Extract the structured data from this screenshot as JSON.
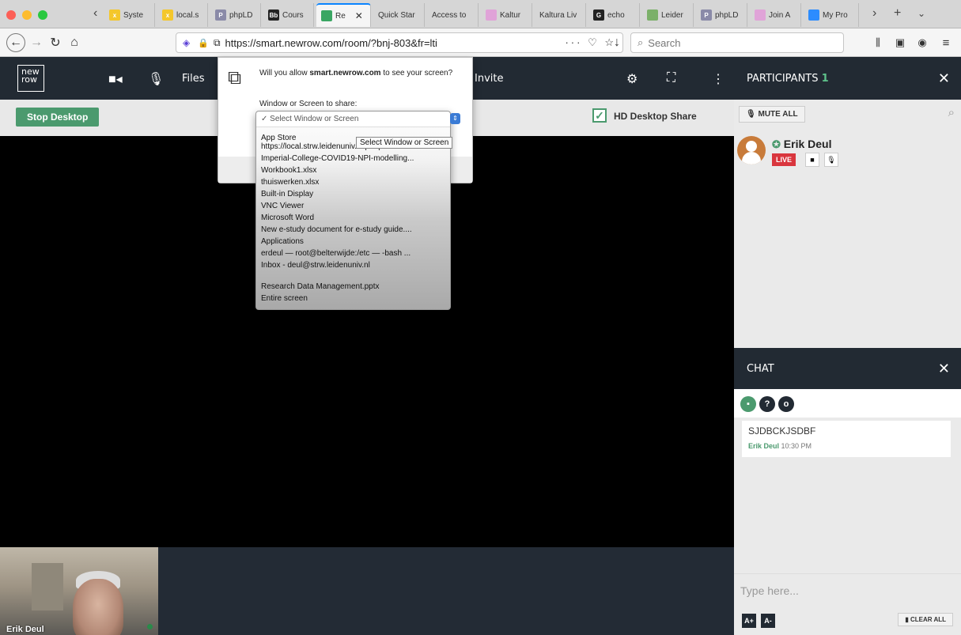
{
  "browser": {
    "tabs": [
      {
        "label": "Syste",
        "fav_color": "#f4c72b",
        "fav_text": "x"
      },
      {
        "label": "local.s",
        "fav_color": "#f4c72b",
        "fav_text": "x"
      },
      {
        "label": "phpLD",
        "fav_color": "#8a8aa8",
        "fav_text": "P"
      },
      {
        "label": "Cours",
        "fav_color": "#222222",
        "fav_text": "Bb"
      },
      {
        "label": "Re",
        "fav_color": "#3aa663",
        "fav_text": ""
      },
      {
        "label": "Quick Star",
        "fav_color": "",
        "fav_text": ""
      },
      {
        "label": "Access to",
        "fav_color": "",
        "fav_text": ""
      },
      {
        "label": "Kaltur",
        "fav_color": "#e0a3d8",
        "fav_text": ""
      },
      {
        "label": "Kaltura Liv",
        "fav_color": "",
        "fav_text": ""
      },
      {
        "label": "echo",
        "fav_color": "#222222",
        "fav_text": "G"
      },
      {
        "label": "Leider",
        "fav_color": "#7bb069",
        "fav_text": ""
      },
      {
        "label": "phpLD",
        "fav_color": "#8a8aa8",
        "fav_text": "P"
      },
      {
        "label": "Join A",
        "fav_color": "#e0a3d8",
        "fav_text": ""
      },
      {
        "label": "My Pro",
        "fav_color": "#2d8cff",
        "fav_text": ""
      }
    ],
    "url": "https://smart.newrow.com/room/?bnj-803&fr=lti",
    "search_placeholder": "Search",
    "close_tab": "✕",
    "new_tab": "+"
  },
  "toolbar": {
    "logo": "new row",
    "files": "Files",
    "invite": "Invite"
  },
  "subbar": {
    "stop_desktop": "Stop Desktop",
    "hd_desktop_share": "HD Desktop Share"
  },
  "popup": {
    "question_pre": "Will you allow ",
    "question_domain": "smart.newrow.com",
    "question_post": " to see your screen?",
    "window_label": "Window or Screen to share:",
    "selected": "✓ Select Window or Screen",
    "tooltip": "Select Window or Screen",
    "options": [
      {
        "text": "App Store",
        "bold": false
      },
      {
        "text": "https://local.strw.leidenuniv.nl/people/tou...",
        "bold": false
      },
      {
        "text": "Imperial-College-COVID19-NPI-modelling...",
        "bold": false
      },
      {
        "text": "Workbook1.xlsx",
        "bold": false
      },
      {
        "text": "thuiswerken.xlsx",
        "bold": false
      },
      {
        "text": "Built-in Display",
        "bold": false
      },
      {
        "text": "VNC Viewer",
        "bold": false
      },
      {
        "text": "Microsoft Word",
        "bold": false
      },
      {
        "text": "New e-study document for e-study guide....",
        "bold": false
      },
      {
        "text": "Applications",
        "bold": false
      },
      {
        "text": "erdeul — root@belterwijde:/etc — -bash ...",
        "bold": false
      },
      {
        "text": "Inbox - deul@strw.leidenuniv.nl",
        "bold": false
      },
      {
        "text": "",
        "bold": false
      },
      {
        "text": "Research Data Management.pptx",
        "bold": false
      },
      {
        "text": "Entire screen",
        "bold": false
      }
    ]
  },
  "participants": {
    "title": "PARTICIPANTS",
    "count": "1",
    "mute_all": "MUTE ALL",
    "list": [
      {
        "name": "Erik Deul",
        "live": "LIVE"
      }
    ]
  },
  "chat": {
    "title": "CHAT",
    "messages": [
      {
        "text": "SJDBCKJSDBF",
        "author": "Erik Deul",
        "time": "10:30 PM"
      }
    ],
    "input_placeholder": "Type here...",
    "font_up": "A+",
    "font_down": "A-",
    "clear_all": "CLEAR ALL"
  },
  "video": {
    "name": "Erik Deul"
  },
  "colors": {
    "dark_bar": "#222a33",
    "accent_green": "#4b9a6e",
    "live_red": "#d9363e"
  }
}
